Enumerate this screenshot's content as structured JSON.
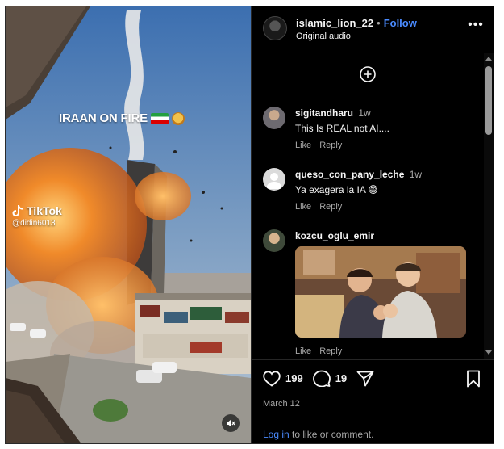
{
  "post": {
    "username": "islamic_lion_22",
    "separator": "•",
    "follow_label": "Follow",
    "audio_label": "Original audio",
    "more_label": "•••"
  },
  "media": {
    "overlay_title": "IRAAN ON FIRE",
    "watermark_brand": "TikTok",
    "watermark_handle": "@didin6013",
    "muted": true
  },
  "comments": [
    {
      "username": "sigitandharu",
      "time": "1w",
      "text": "This Is REAL not AI....",
      "like_label": "Like",
      "reply_label": "Reply"
    },
    {
      "username": "queso_con_pany_leche",
      "time": "1w",
      "text": "Ya exagera la IA 😅",
      "like_label": "Like",
      "reply_label": "Reply"
    },
    {
      "username": "kozcu_oglu_emir",
      "time": "",
      "text": "",
      "has_image": true,
      "like_label": "Like",
      "reply_label": "Reply"
    }
  ],
  "footer": {
    "likes": "199",
    "comments_count": "19",
    "date": "March 12",
    "login_label": "Log in",
    "login_suffix": " to like or comment."
  },
  "colors": {
    "background": "#000000",
    "link": "#4a8bff",
    "muted_text": "#a8a8a8",
    "text": "#f5f5f5"
  }
}
